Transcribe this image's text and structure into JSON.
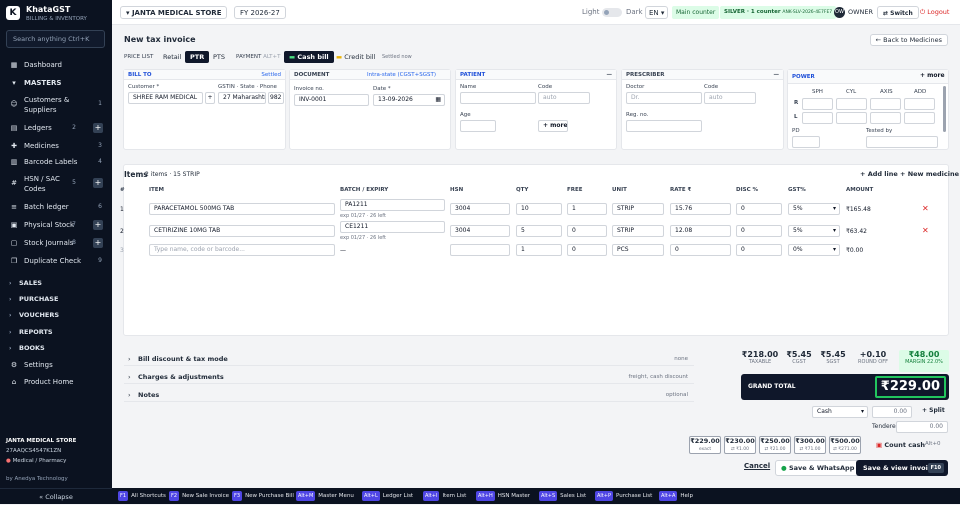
{
  "app": {
    "logo_letter": "K",
    "name": "KhataGST",
    "tagline": "BILLING & INVENTORY"
  },
  "sidebar": {
    "search_placeholder": "Search anything  Ctrl+K",
    "items": [
      {
        "label": "Dashboard",
        "icon": "grid-icon",
        "glyph": "▦",
        "count": "",
        "plus": false
      },
      {
        "label": "MASTERS",
        "icon": "chevron-down-icon",
        "glyph": "▾",
        "count": "",
        "plus": false
      },
      {
        "label": "Customers & Suppliers",
        "icon": "users-icon",
        "glyph": "☺",
        "count": "1",
        "plus": false
      },
      {
        "label": "Ledgers",
        "icon": "book-icon",
        "glyph": "▤",
        "count": "2",
        "plus": true
      },
      {
        "label": "Medicines",
        "icon": "pill-icon",
        "glyph": "✚",
        "count": "3",
        "plus": false
      },
      {
        "label": "Barcode Labels",
        "icon": "tag-icon",
        "glyph": "▥",
        "count": "4",
        "plus": false
      },
      {
        "label": "HSN / SAC Codes",
        "icon": "hash-icon",
        "glyph": "#",
        "count": "5",
        "plus": true
      },
      {
        "label": "Batch ledger",
        "icon": "layers-icon",
        "glyph": "≡",
        "count": "6",
        "plus": false
      },
      {
        "label": "Physical Stock",
        "icon": "box-icon",
        "glyph": "▣",
        "count": "7",
        "plus": true
      },
      {
        "label": "Stock Journals",
        "icon": "journal-icon",
        "glyph": "▢",
        "count": "8",
        "plus": true
      },
      {
        "label": "Duplicate Check",
        "icon": "copy-icon",
        "glyph": "❐",
        "count": "9",
        "plus": false
      }
    ],
    "groups": [
      "SALES",
      "PURCHASE",
      "VOUCHERS",
      "REPORTS",
      "BOOKS"
    ],
    "bottom_items": [
      {
        "label": "Settings",
        "icon": "gear-icon",
        "glyph": "⚙"
      },
      {
        "label": "Product Home",
        "icon": "home-icon",
        "glyph": "⌂"
      }
    ],
    "company": "JANTA MEDICAL STORE",
    "gstin": "27AAQCS4547K1ZN",
    "business_type": "Medical / Pharmacy",
    "credit": "by Anedya Technology",
    "collapse_label": "« Collapse"
  },
  "topbar": {
    "company": "JANTA MEDICAL STORE",
    "fy": "FY 2026-27",
    "theme_light": "Light",
    "theme_dark": "Dark",
    "lang": "EN",
    "counter": "Main counter",
    "plan": "SILVER · 1 counter",
    "license": "ANK-SLV-2026-4E7FE7",
    "avatar": "OW",
    "role": "OWNER",
    "switch_label": "Switch",
    "logout_label": "Logout"
  },
  "invoice": {
    "title": "New tax invoice",
    "back_label": "Back to Medicines",
    "price_list_label": "PRICE LIST",
    "price_lists": [
      "Retail",
      "PTR",
      "PTS"
    ],
    "active_price_list": "PTR",
    "payment_label": "PAYMENT",
    "payment_shortcut": "ALT+T",
    "cash_bill": "Cash bill",
    "credit_bill": "Credit bill",
    "settled": "Settled now"
  },
  "bill_to": {
    "header": "BILL TO",
    "status": "Settled",
    "customer_label": "Customer *",
    "customer_value": "SHREE RAM MEDICAL",
    "gstin_label": "GSTIN · State · Phone",
    "state_value": "27 Maharashtra",
    "phone_value": "982"
  },
  "document": {
    "header": "DOCUMENT",
    "tax_mode": "Intra-state (CGST+SGST)",
    "invoice_no_label": "Invoice no.",
    "invoice_no": "INV-0001",
    "date_label": "Date *",
    "date": "13-09-2026"
  },
  "patient": {
    "header": "PATIENT",
    "name_label": "Name",
    "code_label": "Code",
    "code_placeholder": "auto",
    "age_label": "Age",
    "more_label": "+ more"
  },
  "prescriber": {
    "header": "PRESCRIBER",
    "doctor_label": "Doctor",
    "doctor_placeholder": "Dr.",
    "code_label": "Code",
    "code_placeholder": "auto",
    "reg_label": "Reg. no."
  },
  "power": {
    "header": "POWER",
    "more_label": "+ more",
    "cols": [
      "SPH",
      "CYL",
      "AXIS",
      "ADD"
    ],
    "rows": [
      "R",
      "L"
    ],
    "pd_label": "PD",
    "tested_label": "Tested by"
  },
  "items": {
    "title": "Items",
    "summary": "2 items · 15 STRIP",
    "add_line": "+ Add line",
    "new_medicine": "+ New medicine",
    "headers": [
      "#",
      "ITEM",
      "BATCH / EXPIRY",
      "HSN",
      "QTY",
      "FREE",
      "UNIT",
      "RATE ₹",
      "DISC %",
      "GST%",
      "AMOUNT"
    ],
    "rows": [
      {
        "no": "1",
        "item": "PARACETAMOL 500MG TAB",
        "batch": "PA1211",
        "expiry": "exp 01/27 · 26 left",
        "hsn": "3004",
        "qty": "10",
        "free": "1",
        "unit": "STRIP",
        "rate": "15.76",
        "disc": "0",
        "gst": "5%",
        "amount": "₹165.48"
      },
      {
        "no": "2",
        "item": "CETIRIZINE 10MG TAB",
        "batch": "CE1211",
        "expiry": "exp 01/27 · 26 left",
        "hsn": "3004",
        "qty": "5",
        "free": "0",
        "unit": "STRIP",
        "rate": "12.08",
        "disc": "0",
        "gst": "5%",
        "amount": "₹63.42"
      }
    ],
    "new_row": {
      "no": "3",
      "item_placeholder": "Type name, code or barcode...",
      "batch": "—",
      "qty": "1",
      "free": "0",
      "unit": "PCS",
      "rate": "0",
      "disc": "0",
      "gst": "0%",
      "amount": "₹0.00"
    }
  },
  "accordion": [
    {
      "label": "Bill discount & tax mode",
      "hint": "none"
    },
    {
      "label": "Charges & adjustments",
      "hint": "freight, cash discount"
    },
    {
      "label": "Notes",
      "hint": "optional"
    }
  ],
  "totals": {
    "taxable": "₹218.00",
    "taxable_label": "TAXABLE",
    "cgst": "₹5.45",
    "cgst_label": "CGST",
    "sgst": "₹5.45",
    "sgst_label": "SGST",
    "round_off": "+0.10",
    "round_off_label": "ROUND OFF",
    "margin_value": "₹48.00",
    "margin_label": "MARGIN 22.0%",
    "grand_label": "GRAND TOTAL",
    "grand_value": "₹229.00"
  },
  "payment": {
    "mode": "Cash",
    "amount": "0.00",
    "split_label": "+ Split",
    "tendered_label": "Tendered",
    "tendered_value": "0.00",
    "quick": [
      {
        "amount": "₹229.00",
        "sub": "exact"
      },
      {
        "amount": "₹230.00",
        "sub": "⇄ ₹1.00"
      },
      {
        "amount": "₹250.00",
        "sub": "⇄ ₹21.00"
      },
      {
        "amount": "₹300.00",
        "sub": "⇄ ₹71.00"
      },
      {
        "amount": "₹500.00",
        "sub": "⇄ ₹271.00"
      }
    ],
    "count_cash": "Count cash",
    "count_shortcut": "Alt+0",
    "cancel": "Cancel",
    "save_whatsapp": "Save & WhatsApp",
    "save_view": "Save & view invoice",
    "save_shortcut": "F10"
  },
  "shortcuts": [
    {
      "key": "F1",
      "label": "All Shortcuts"
    },
    {
      "key": "F2",
      "label": "New Sale Invoice"
    },
    {
      "key": "F3",
      "label": "New Purchase Bill"
    },
    {
      "key": "Alt+M",
      "label": "Master Menu"
    },
    {
      "key": "Alt+L",
      "label": "Ledger List"
    },
    {
      "key": "Alt+I",
      "label": "Item List"
    },
    {
      "key": "Alt+H",
      "label": "HSN Master"
    },
    {
      "key": "Alt+S",
      "label": "Sales List"
    },
    {
      "key": "Alt+P",
      "label": "Purchase List"
    },
    {
      "key": "Alt+A",
      "label": "Help"
    }
  ],
  "colors": {
    "sidebar": "#0b1220",
    "accent": "#4f46e5",
    "green": "#16a34a",
    "grand": "#0f172a"
  }
}
